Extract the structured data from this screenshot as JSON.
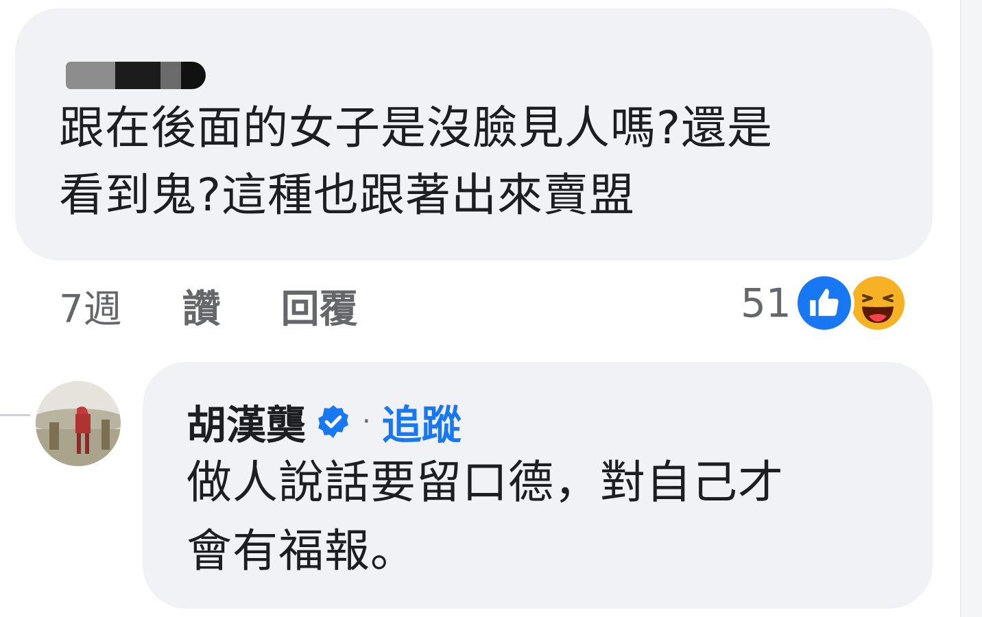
{
  "comment": {
    "author_redacted": true,
    "text": "跟在後面的女子是沒臉見人嗎?還是\n看到鬼?這種也跟著出來賣盟"
  },
  "actions": {
    "time": "7週",
    "like_label": "讚",
    "reply_label": "回覆",
    "reaction_count": "51",
    "reactions": [
      "like-icon",
      "haha-icon"
    ]
  },
  "reply": {
    "author": "胡漢龑",
    "verified": true,
    "separator": "·",
    "follow_label": "追蹤",
    "text": "做人說話要留口德，對自己才\n會有福報。"
  },
  "colors": {
    "bubble": "#f0f2f5",
    "text": "#1c1e21",
    "secondary": "#65676b",
    "accent": "#1877f2",
    "haha": "#f7b125"
  }
}
